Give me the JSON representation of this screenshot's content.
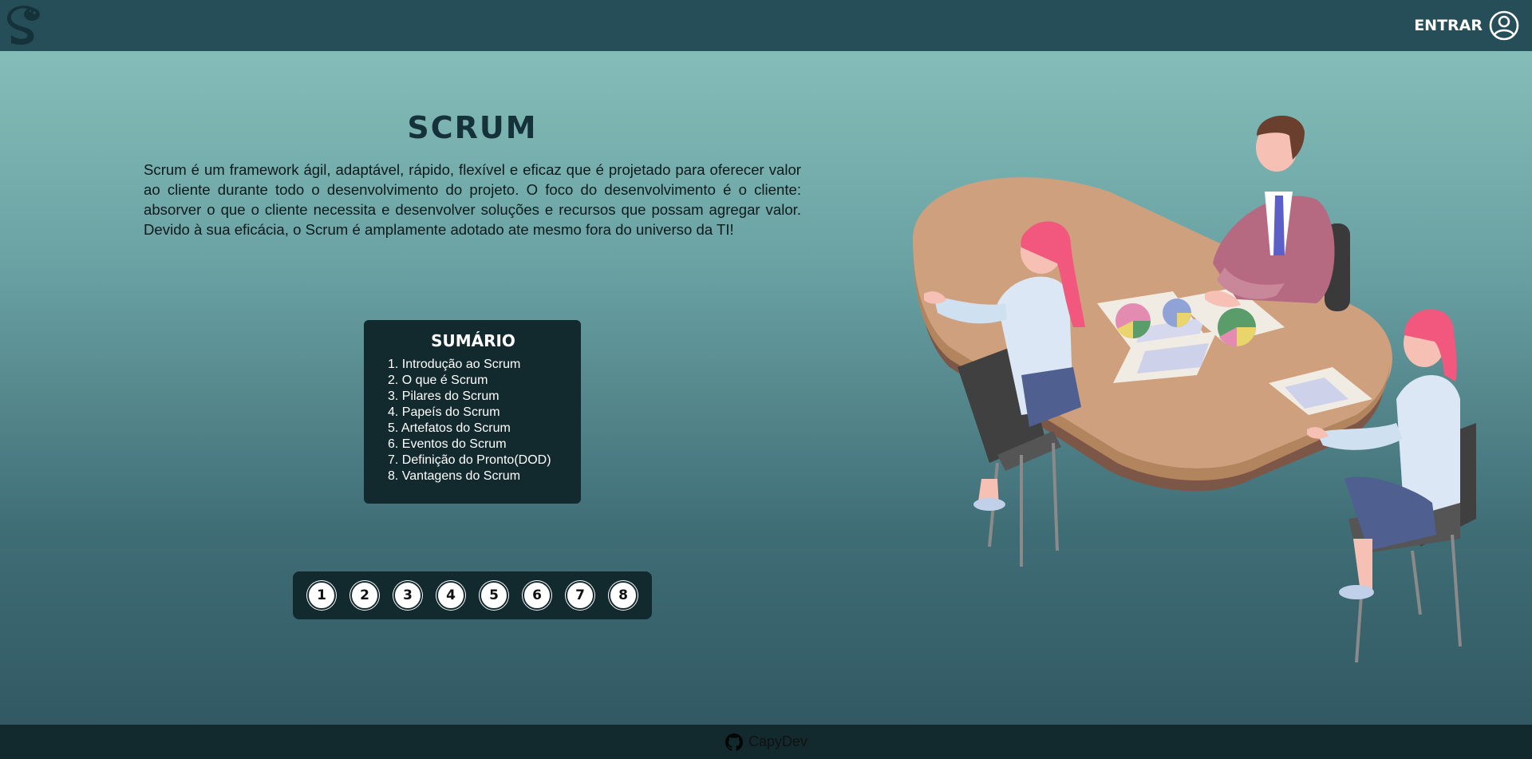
{
  "header": {
    "logo_icon": "capybara-logo-icon",
    "login_label": "ENTRAR",
    "user_icon": "user-circle-icon"
  },
  "main": {
    "title": "SCRUM",
    "intro": "Scrum é um framework ágil, adaptável, rápido, flexível e eficaz que é projetado para oferecer valor ao cliente durante todo o desenvolvimento do projeto. O foco do desenvolvimento é o cliente: absorver o que o cliente necessita e desenvolver soluções e recursos que possam agregar valor. Devido à sua eficácia, o Scrum é amplamente adotado ate mesmo fora do universo da TI!"
  },
  "summary": {
    "title": "SUMÁRIO",
    "items": [
      "1. Introdução ao Scrum",
      "2. O que é Scrum",
      "3. Pilares do Scrum",
      "4. Papeís do Scrum",
      "5. Artefatos do Scrum",
      "6. Eventos do Scrum",
      "7. Definição do Pronto(DOD)",
      "8. Vantagens do Scrum"
    ]
  },
  "pager": {
    "pages": [
      "1",
      "2",
      "3",
      "4",
      "5",
      "6",
      "7",
      "8"
    ]
  },
  "illustration": {
    "icon": "team-meeting-illustration"
  },
  "footer": {
    "icon": "github-icon",
    "link": "CapyDev"
  },
  "colors": {
    "header_bg": "#254e59",
    "panel_bg": "#12292e",
    "gradient_top": "#8bc3be",
    "gradient_bottom": "#2f5560",
    "title_color": "#15323a"
  }
}
